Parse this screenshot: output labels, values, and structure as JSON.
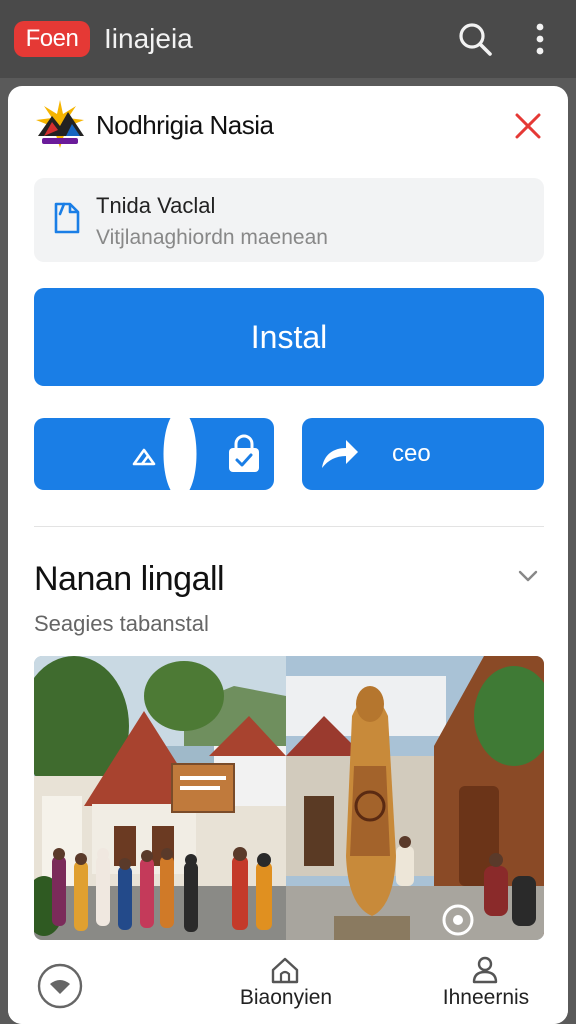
{
  "appbar": {
    "badge": "Foen",
    "title": "Iinajeia",
    "icons": [
      "search-icon",
      "more-vert-icon"
    ],
    "badge_color": "#e53935"
  },
  "header": {
    "developer_name": "Nodhrigia Nasia",
    "close_icon": "close-icon",
    "close_color": "#e53935"
  },
  "info": {
    "title": "Tnida Vaclal",
    "subtitle": "Vitjlanaghiordn maenean",
    "icon": "document-icon"
  },
  "install": {
    "label": "Instal",
    "color": "#1a7ee6"
  },
  "actions": {
    "left_icons": [
      "hanger-icon",
      "lock-bag-icon"
    ],
    "right_icon": "share-arrow-icon",
    "right_label": "ceo"
  },
  "section": {
    "title": "Nanan lingall",
    "subtitle": "Seagies tabanstal",
    "chevron": "chevron-down-icon"
  },
  "gallery": {
    "images": [
      "village-gathering-photo",
      "carved-statue-photo"
    ]
  },
  "bottom_nav": {
    "left_icon": "home-circle-icon",
    "middle": {
      "label": "Biaonyien",
      "icon": "home-icon"
    },
    "right": {
      "label": "Ihneernis",
      "icon": "person-icon"
    }
  }
}
